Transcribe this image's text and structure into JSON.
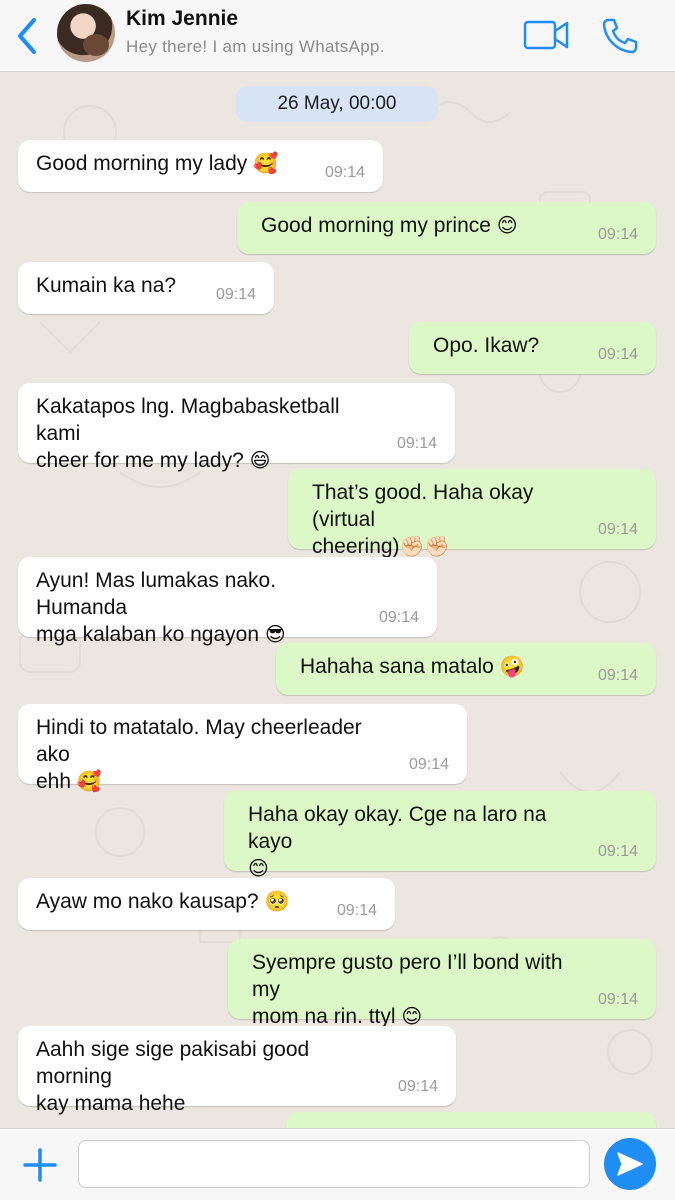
{
  "header": {
    "contact_name": "Kim Jennie",
    "status": "Hey there! I am using WhatsApp.",
    "back_icon": "chevron-left-icon",
    "video_icon": "video-camera-icon",
    "call_icon": "phone-icon"
  },
  "chat": {
    "date_label": "26 May, 00:00",
    "messages": [
      {
        "dir": "in",
        "text": "Good morning my lady",
        "emoji": "🥰",
        "time": "09:14"
      },
      {
        "dir": "out",
        "text": "Good morning my prince",
        "emoji": "😊",
        "time": "09:14"
      },
      {
        "dir": "in",
        "text": "Kumain ka na?",
        "emoji": "",
        "time": "09:14"
      },
      {
        "dir": "out",
        "text": "Opo. Ikaw?",
        "emoji": "",
        "time": "09:14"
      },
      {
        "dir": "in",
        "text": "Kakatapos lng. Magbabasketball kami\ncheer for me my lady?",
        "emoji": "😄",
        "time": "09:14"
      },
      {
        "dir": "out",
        "text": "That’s good. Haha okay (virtual\ncheering)",
        "emoji": "✊🏻✊🏻",
        "time": "09:14"
      },
      {
        "dir": "in",
        "text": "Ayun! Mas lumakas nako. Humanda\nmga kalaban ko ngayon",
        "emoji": "😎",
        "time": "09:14"
      },
      {
        "dir": "out",
        "text": "Hahaha sana matalo",
        "emoji": "🤪",
        "time": "09:14"
      },
      {
        "dir": "in",
        "text": "Hindi to matatalo. May cheerleader ako\nehh",
        "emoji": "🥰",
        "time": "09:14"
      },
      {
        "dir": "out",
        "text": "Haha okay okay. Cge na laro na kayo\n",
        "emoji": "😊",
        "time": "09:14"
      },
      {
        "dir": "in",
        "text": "Ayaw mo nako kausap?",
        "emoji": "🥺",
        "time": "09:14"
      },
      {
        "dir": "out",
        "text": "Syempre gusto pero I’ll bond with my\nmom na rin. ttyl",
        "emoji": "😊",
        "time": "09:14"
      },
      {
        "dir": "in",
        "text": "Aahh sige sige pakisabi good morning\nkay mama hehe",
        "emoji": "",
        "time": "09:14"
      }
    ]
  },
  "input": {
    "placeholder": "",
    "plus_icon": "plus-icon",
    "send_icon": "send-arrow-icon"
  },
  "colors": {
    "accent": "#1e8ef5",
    "incoming_bubble": "#ffffff",
    "outgoing_bubble": "#dcf8c6",
    "date_pill": "#d6e4f5",
    "chat_background": "#ebe6df"
  }
}
